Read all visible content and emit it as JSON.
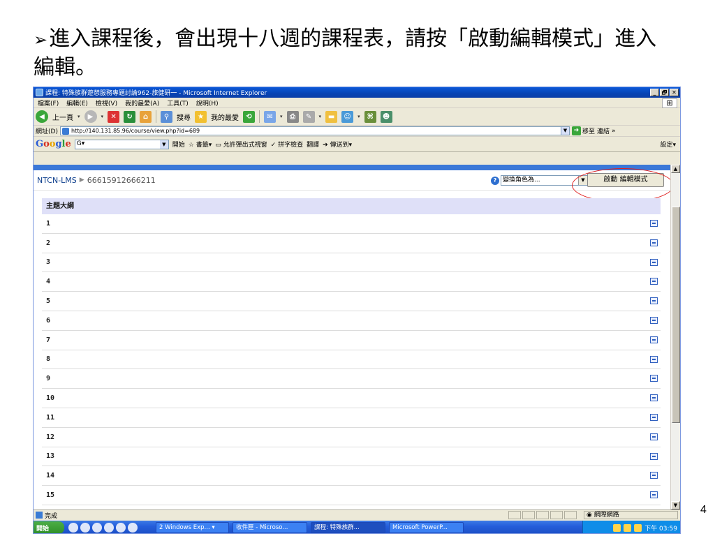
{
  "slide": {
    "bullet": "➢",
    "text": "進入課程後，會出現十八週的課程表，請按「啟動編輯模式」進入編輯。",
    "page_number": "4"
  },
  "window": {
    "title": "課程: 特殊族群遊憩服務專題討論962-旅健研一 - Microsoft Internet Explorer",
    "controls": [
      "_",
      "🗗",
      "✕"
    ]
  },
  "menu": [
    "檔案(F)",
    "編輯(E)",
    "檢視(V)",
    "我的最愛(A)",
    "工具(T)",
    "說明(H)"
  ],
  "toolbar": {
    "back": "上一頁",
    "search": "搜尋",
    "favorites": "我的最愛"
  },
  "address": {
    "label": "網址(D)",
    "url": "http://140.131.85.96/course/view.php?id=689",
    "go": "移至",
    "links": "連結"
  },
  "googlebar": {
    "logo": [
      "G",
      "o",
      "o",
      "g",
      "l",
      "e"
    ],
    "search_value": "G▾",
    "start": "開始",
    "bookmarks": "書籤▾",
    "popup": "允許彈出式視窗",
    "spell": "拼字檢查",
    "translate": "翻譯",
    "send": "傳送到▾",
    "settings": "設定▾"
  },
  "page": {
    "site": "NTCN-LMS",
    "course_id": "66615912666211",
    "role_label": "變換角色為...",
    "edit_button": "啟動 編輯模式",
    "outline_heading": "主題大綱",
    "weeks": [
      "1",
      "2",
      "3",
      "4",
      "5",
      "6",
      "7",
      "8",
      "9",
      "10",
      "11",
      "12",
      "13",
      "14",
      "15"
    ]
  },
  "status": {
    "text": "完成",
    "zone": "網際網路"
  },
  "taskbar": {
    "start": "開始",
    "tasks": [
      "2 Windows Exp... ▾",
      "收件匣 - Microso...",
      "課程: 特殊族群...",
      "Microsoft PowerP..."
    ],
    "clock": "下午 03:59"
  },
  "colors": {
    "accent": "#3b78d8",
    "outline_header": "#dfe0f8",
    "highlight": "#e02020"
  }
}
